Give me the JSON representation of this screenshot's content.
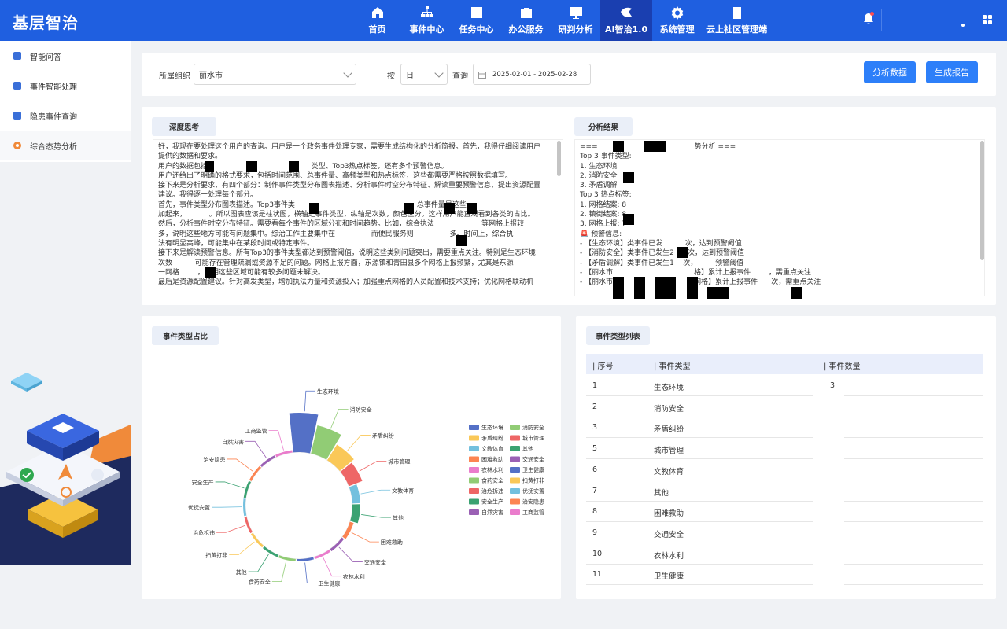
{
  "brand": "基层智治",
  "nav": [
    {
      "label": "首页",
      "icon": "home-icon"
    },
    {
      "label": "事件中心",
      "icon": "org-chart-icon"
    },
    {
      "label": "任务中心",
      "icon": "task-list-icon"
    },
    {
      "label": "办公服务",
      "icon": "briefcase-icon"
    },
    {
      "label": "研判分析",
      "icon": "analysis-board-icon"
    },
    {
      "label": "AI智治1.0",
      "icon": "ai-logo-icon"
    },
    {
      "label": "系统管理",
      "icon": "gear-icon"
    },
    {
      "label": "云上社区管理端",
      "icon": "building-icon"
    }
  ],
  "sidebar": [
    {
      "label": "智能问答",
      "icon": "user-qa-icon",
      "color": "#3a6fd8"
    },
    {
      "label": "事件智能处理",
      "icon": "document-icon",
      "color": "#3a6fd8"
    },
    {
      "label": "隐患事件查询",
      "icon": "cloud-search-icon",
      "color": "#3a6fd8"
    },
    {
      "label": "综合态势分析",
      "icon": "target-icon",
      "color": "#f08a3a"
    }
  ],
  "filter": {
    "org_label": "所属组织",
    "org_value": "丽水市",
    "by_label": "按",
    "by_value": "日",
    "query_label": "查询",
    "date_range": "2025-02-01 - 2025-02-28",
    "analyze_button": "分析数据",
    "report_button": "生成报告"
  },
  "deep_think": {
    "title": "深度思考",
    "lines": [
      "好，我现在要处理这个用户的查询。用户是一个政务事件处理专家，需要生成结构化的分析简报。首先，我得仔细阅读用户",
      "提供的数据和要求。",
      "用户的数据包括                                              类型、Top3热点标签，还有多个预警信息。",
      "用户还给出了明确的格式要求，包括时间范围、总事件量、高频类型和热点标签，这些都需要严格按照数据填写。",
      "接下来是分析要求，有四个部分：制作事件类型分布图表描述、分析事件时空分布特征、解读重要预警信息、提出资源配置",
      "建议。我得逐一处理每个部分。",
      "首先，事件类型分布图表描述。Top3事件类                                                   。总事件量是这些",
      "加起来，          。所以图表应该是柱状图，横轴是事件类型，纵轴是次数，颜色区分。这样用户能直观看到各类的占比。",
      "然后，分析事件时空分布特征。需要看每个事件的区域分布和时间趋势。比如，综合执法                     等网格上报较",
      "多，说明这些地方可能有问题集中。综治工作主要集中在                而便民服务则                多。时间上，综合执",
      "法有明显高峰，可能集中在某段时间或特定事件。",
      "接下来是解读预警信息。所有Top3的事件类型都达到预警阈值，说明这些类别问题突出，需要重点关注。特别是生态环境",
      "次数          可能存在管理疏漏或资源不足的问题。网格上报方面，东源镇和青田县多个网格上报频繁，尤其是东源",
      "一网格        ，说明这些区域可能有较多问题未解决。",
      "最后是资源配置建议。针对高发类型，增加执法力量和资源投入；加强重点网格的人员配置和技术支持；优化网格联动机"
    ]
  },
  "result": {
    "title": "分析结果",
    "lines": [
      "===                                           势分析 ===",
      "Top 3 事件类型:",
      "1. 生态环境",
      "2. 消防安全",
      "3. 矛盾调解",
      "Top 3 热点标签:",
      "1. 网格结案: 8",
      "2. 镇街结案: 8",
      "3. 网格上报: 7",
      "🚨 预警信息:",
      "- 【生态环境】类事件已发          次，达到预警阈值",
      "- 【消防安全】类事件已发生2      次，达到预警阈值",
      "- 【矛盾调解】类事件已发生1    次，        预警阈值",
      "- 【丽水市                                    格】累计上报事件        ，需重点关注",
      "- 【丽水市                                    网格】累计上报事件      次，需重点关注"
    ]
  },
  "pie": {
    "title": "事件类型占比"
  },
  "table": {
    "title": "事件类型列表",
    "headers": [
      "| 序号",
      "| 事件类型",
      "| 事件数量"
    ],
    "rows": [
      {
        "no": "1",
        "type": "生态环境",
        "count": "3"
      },
      {
        "no": "2",
        "type": "消防安全",
        "count": ""
      },
      {
        "no": "3",
        "type": "矛盾纠纷",
        "count": ""
      },
      {
        "no": "5",
        "type": "城市管理",
        "count": ""
      },
      {
        "no": "6",
        "type": "文教体育",
        "count": ""
      },
      {
        "no": "7",
        "type": "其他",
        "count": ""
      },
      {
        "no": "8",
        "type": "困难救助",
        "count": ""
      },
      {
        "no": "9",
        "type": "交通安全",
        "count": ""
      },
      {
        "no": "10",
        "type": "农林水利",
        "count": ""
      },
      {
        "no": "11",
        "type": "卫生健康",
        "count": ""
      }
    ]
  },
  "chart_data": {
    "type": "pie",
    "variant": "nightingale-rose-ring",
    "title": "事件类型占比",
    "categories": [
      "生态环境",
      "消防安全",
      "矛盾纠纷",
      "城市管理",
      "文教体育",
      "其他",
      "困难救助",
      "交通安全",
      "农林水利",
      "卫生健康",
      "食药安全",
      "其他",
      "扫黄打非",
      "治危拆违",
      "优抚安置",
      "安全生产",
      "治安隐患",
      "自然灾害",
      "工商监管"
    ],
    "values": [
      30,
      22,
      14,
      11,
      6,
      6,
      3,
      2,
      1,
      1,
      1,
      1,
      1,
      1,
      1,
      1,
      1,
      1,
      1
    ],
    "colors": [
      "#5470c6",
      "#91cc75",
      "#fac858",
      "#ee6666",
      "#73c0de",
      "#3ba272",
      "#fc8452",
      "#9a60b4",
      "#ea7ccc",
      "#5470c6",
      "#91cc75",
      "#3ba272",
      "#fac858",
      "#ee6666",
      "#73c0de",
      "#3ba272",
      "#fc8452",
      "#9a60b4",
      "#ea7ccc"
    ],
    "legend": [
      "生态环境",
      "消防安全",
      "矛盾纠纷",
      "城市管理",
      "文教体育",
      "其他",
      "困难救助",
      "交通安全",
      "农林水利",
      "卫生健康",
      "食药安全",
      "扫黄打非",
      "治危拆违",
      "优抚安置",
      "安全生产",
      "治安隐患",
      "自然灾害",
      "工商监管"
    ],
    "legend_colors": [
      "#5470c6",
      "#91cc75",
      "#fac858",
      "#ee6666",
      "#73c0de",
      "#3ba272",
      "#fc8452",
      "#9a60b4",
      "#ea7ccc",
      "#5470c6",
      "#91cc75",
      "#fac858",
      "#ee6666",
      "#73c0de",
      "#3ba272",
      "#fc8452",
      "#9a60b4",
      "#ea7ccc"
    ],
    "legend_position": "right"
  }
}
